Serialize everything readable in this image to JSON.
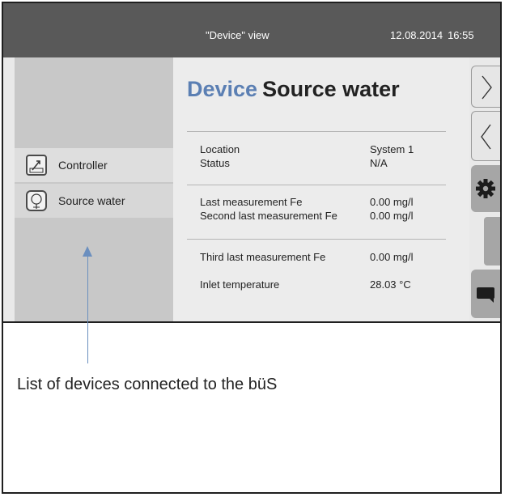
{
  "topbar": {
    "view_title": "\"Device\" view",
    "date": "12.08.2014",
    "time": "16:55"
  },
  "sidebar": {
    "items": [
      {
        "label": "Controller",
        "icon": "controller-icon"
      },
      {
        "label": "Source water",
        "icon": "source-water-icon"
      }
    ]
  },
  "main": {
    "heading_prefix": "Device",
    "heading_name": "Source water",
    "rows": [
      {
        "key": "Location",
        "value": "System 1"
      },
      {
        "key": "Status",
        "value": "N/A"
      },
      {
        "key": "Last measurement Fe",
        "value": "0.00 mg/l"
      },
      {
        "key": "Second last measurement Fe",
        "value": "0.00 mg/l"
      },
      {
        "key": "Third last measurement Fe",
        "value": "0.00 mg/l"
      },
      {
        "key": "Inlet temperature",
        "value": "28.03 °C"
      }
    ]
  },
  "rail": {
    "buttons": [
      "next-icon",
      "previous-icon",
      "gear-icon",
      "scroll-handle",
      "message-icon"
    ]
  },
  "caption": "List of devices connected to the büS",
  "colors": {
    "topbar": "#595959",
    "heading_accent": "#5b7fb3",
    "callout": "#6b8fbf"
  }
}
